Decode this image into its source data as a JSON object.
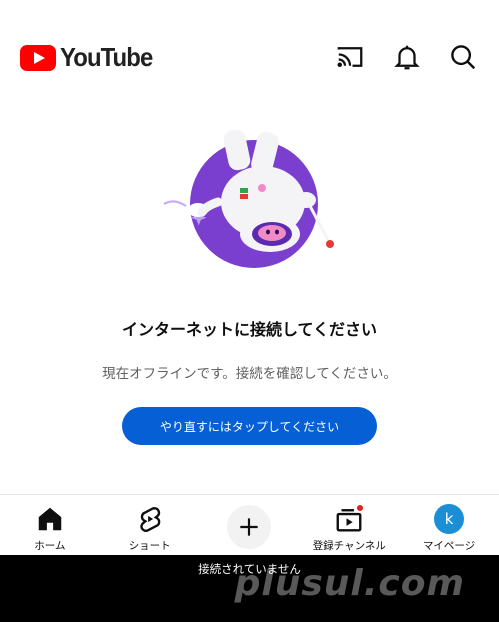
{
  "header": {
    "logo_text": "YouTube"
  },
  "icons": {
    "cast": "cast-icon",
    "notifications": "bell-icon",
    "search": "search-icon",
    "home": "home-icon",
    "shorts": "shorts-icon",
    "create": "plus-icon",
    "subscriptions": "subscriptions-icon"
  },
  "offline": {
    "title": "インターネットに接続してください",
    "message": "現在オフラインです。接続を確認してください。",
    "retry_label": "やり直すにはタップしてください"
  },
  "nav": {
    "home": "ホーム",
    "shorts": "ショート",
    "subscriptions": "登録チャンネル",
    "you": "マイページ",
    "avatar_letter": "k"
  },
  "status": {
    "text": "接続されていません"
  },
  "watermark": "plusul.com",
  "colors": {
    "brand_red": "#ff0000",
    "button_blue": "#065fd4",
    "illustration_purple": "#7b3fd0",
    "avatar_blue": "#1a8fd6"
  }
}
